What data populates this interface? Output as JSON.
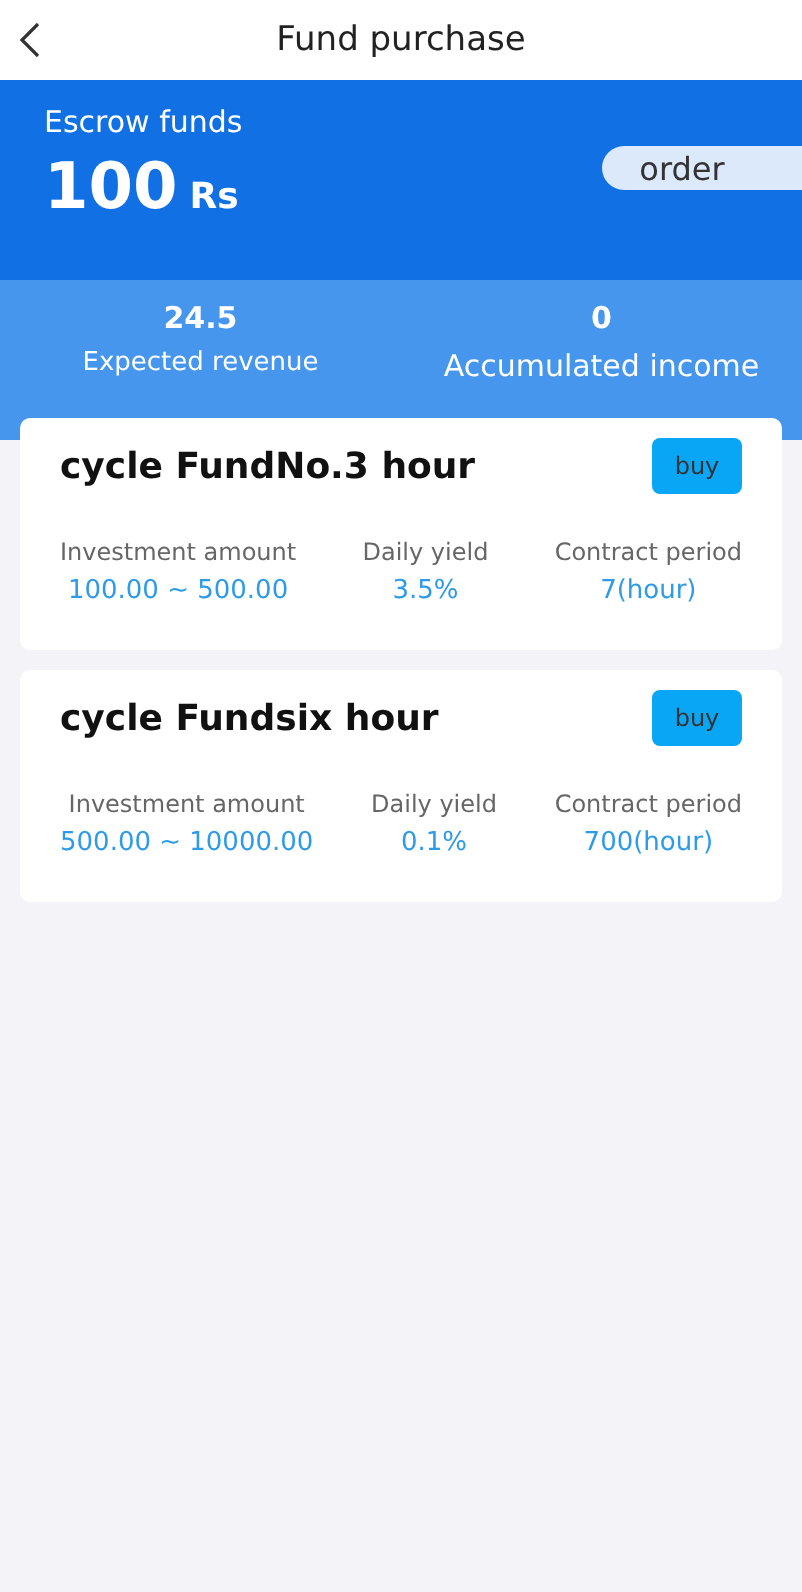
{
  "header": {
    "title": "Fund purchase"
  },
  "escrow": {
    "label": "Escrow funds",
    "amount": "100",
    "unit": "Rs",
    "order_button": "order"
  },
  "stats": [
    {
      "value": "24.5",
      "label": "Expected revenue"
    },
    {
      "value": "0",
      "label": "Accumulated income"
    }
  ],
  "funds": [
    {
      "name": "cycle FundNo.3 hour",
      "button": "buy",
      "fields": [
        {
          "label": "Investment amount",
          "value": "100.00 ~ 500.00"
        },
        {
          "label": "Daily yield",
          "value": "3.5%"
        },
        {
          "label": "Contract period",
          "value": "7(hour)"
        }
      ]
    },
    {
      "name": "cycle Fundsix hour",
      "button": "buy",
      "fields": [
        {
          "label": "Investment amount",
          "value": "500.00 ~ 10000.00"
        },
        {
          "label": "Daily yield",
          "value": "0.1%"
        },
        {
          "label": "Contract period",
          "value": "700(hour)"
        }
      ]
    }
  ]
}
